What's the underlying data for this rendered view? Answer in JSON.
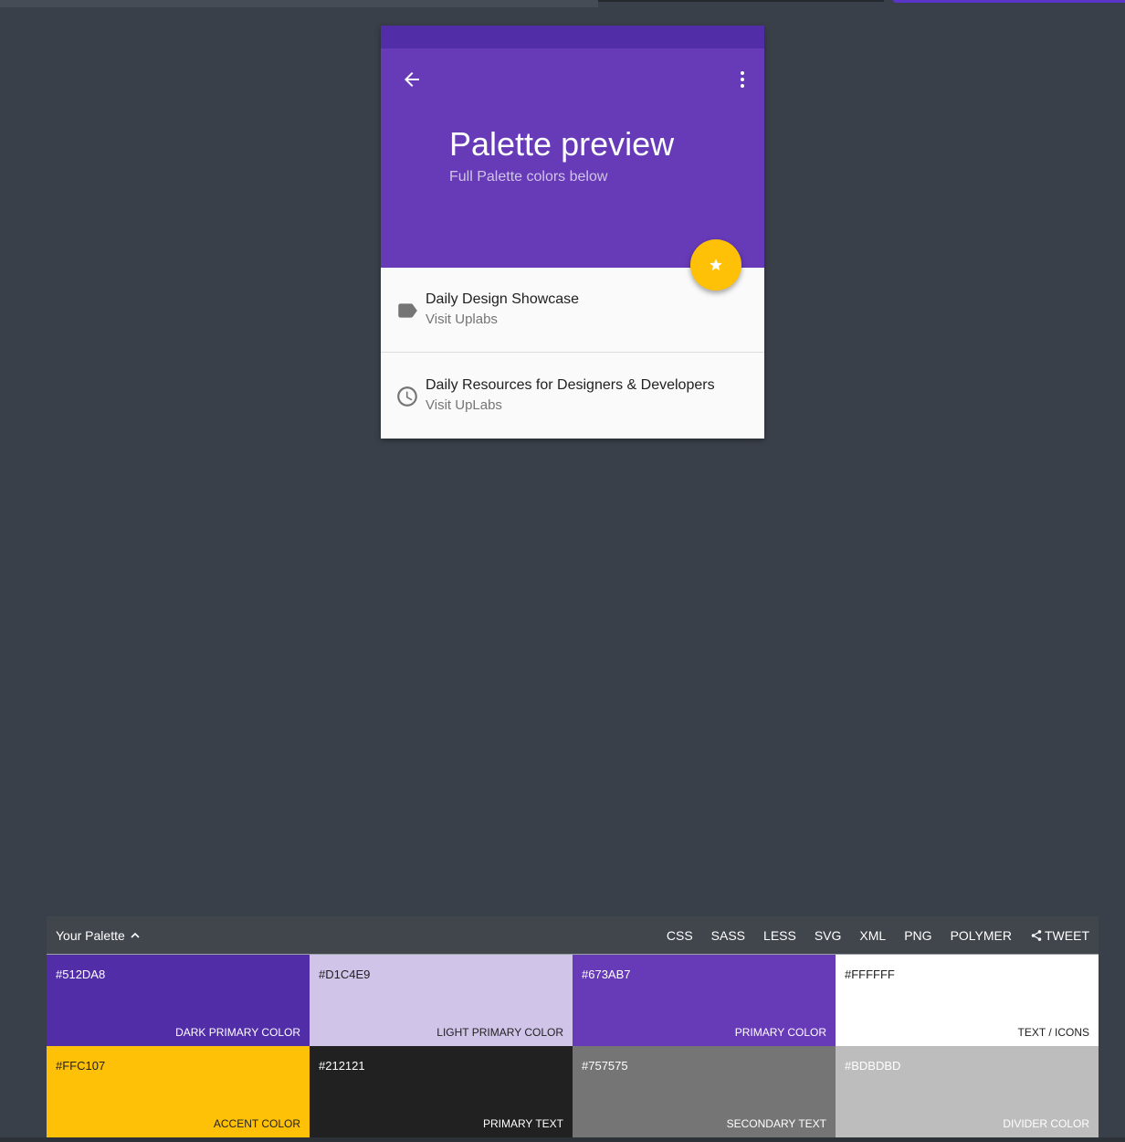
{
  "preview": {
    "title": "Palette preview",
    "subtitle": "Full Palette colors below",
    "items": [
      {
        "primary": "Daily Design Showcase",
        "secondary": "Visit Uplabs",
        "icon": "label-icon"
      },
      {
        "primary": "Daily Resources for Designers & Developers",
        "secondary": "Visit UpLabs",
        "icon": "clock-icon"
      }
    ]
  },
  "palette": {
    "title": "Your Palette",
    "exports": [
      "CSS",
      "SASS",
      "LESS",
      "SVG",
      "XML",
      "PNG",
      "POLYMER"
    ],
    "tweet": "TWEET",
    "swatches": [
      {
        "hex": "#512DA8",
        "label": "DARK PRIMARY COLOR",
        "color": "#512da8",
        "text": "#ffffff"
      },
      {
        "hex": "#D1C4E9",
        "label": "LIGHT PRIMARY COLOR",
        "color": "#d1c4e9",
        "text": "#212121"
      },
      {
        "hex": "#673AB7",
        "label": "PRIMARY COLOR",
        "color": "#673ab7",
        "text": "#ffffff"
      },
      {
        "hex": "#FFFFFF",
        "label": "TEXT / ICONS",
        "color": "#ffffff",
        "text": "#212121"
      },
      {
        "hex": "#FFC107",
        "label": "ACCENT COLOR",
        "color": "#ffc107",
        "text": "#212121"
      },
      {
        "hex": "#212121",
        "label": "PRIMARY TEXT",
        "color": "#212121",
        "text": "#ffffff"
      },
      {
        "hex": "#757575",
        "label": "SECONDARY TEXT",
        "color": "#757575",
        "text": "#ffffff"
      },
      {
        "hex": "#BDBDBD",
        "label": "DIVIDER COLOR",
        "color": "#bdbdbd",
        "text": "#ffffff"
      }
    ]
  }
}
